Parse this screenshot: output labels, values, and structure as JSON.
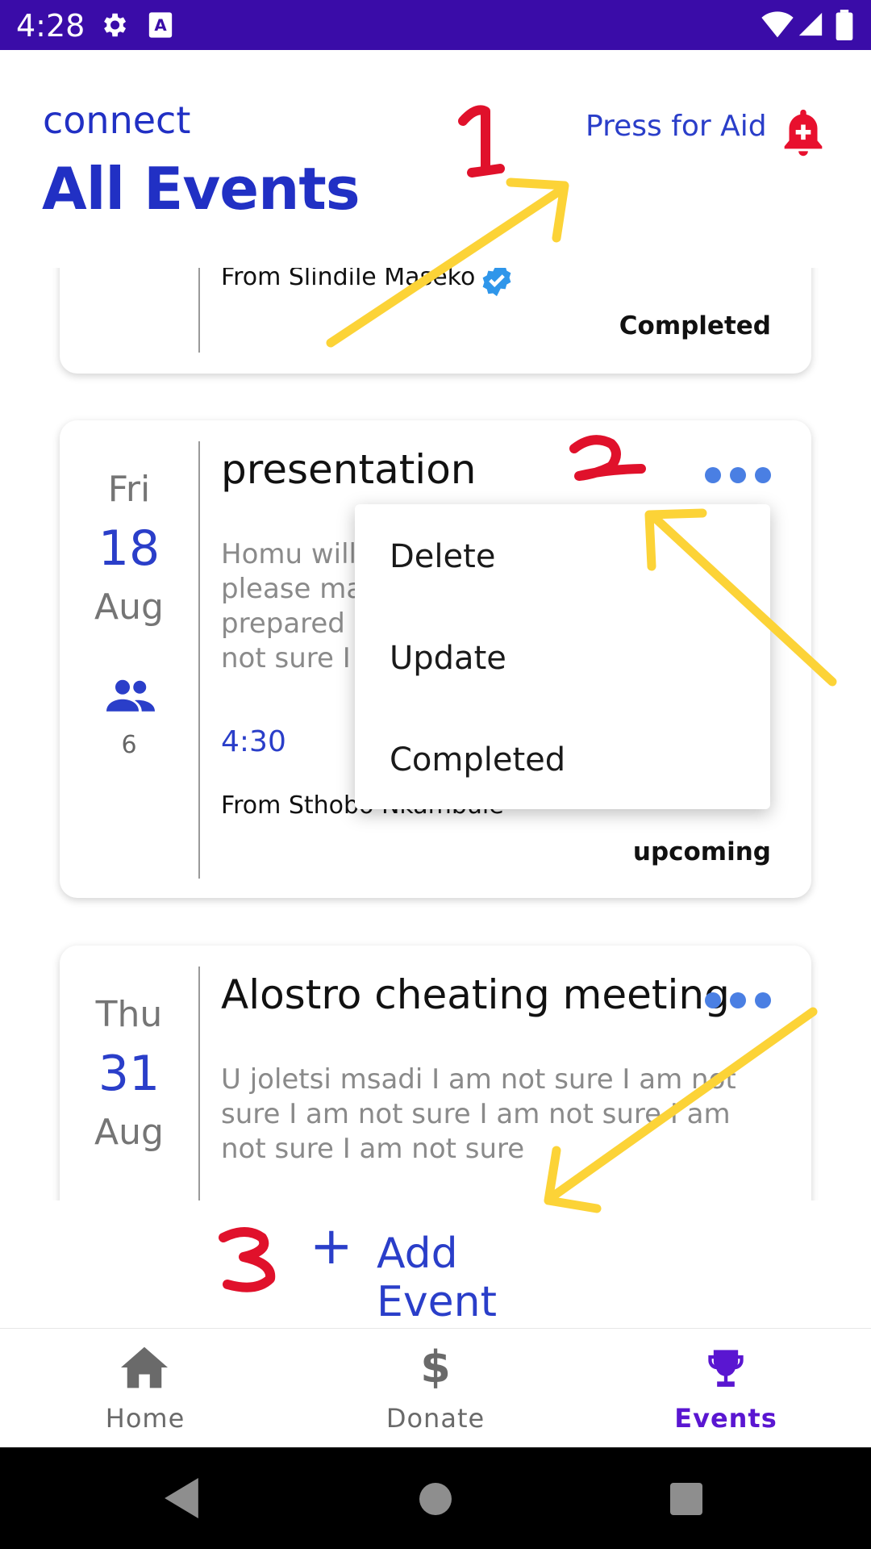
{
  "status_bar": {
    "time": "4:28"
  },
  "header": {
    "app_name": "connect",
    "title": "All Events",
    "aid_label": "Press for Aid"
  },
  "events": [
    {
      "from": "From Slindile Maseko",
      "status": "Completed"
    },
    {
      "day": "Fri",
      "date": "18",
      "month": "Aug",
      "title": "presentation",
      "description_lines": [
        "Homu will",
        "please ma",
        "prepared w",
        "not sure I a"
      ],
      "attendees": "6",
      "time": "4:30",
      "from": "From Sthobo Nkambule",
      "status": "upcoming"
    },
    {
      "day": "Thu",
      "date": "31",
      "month": "Aug",
      "title": "Alostro cheating meeting",
      "description": "U joletsi msadi I am not sure I am not sure I am not sure I am not sure I am not sure I am not sure"
    }
  ],
  "menu": {
    "items": [
      "Delete",
      "Update",
      "Completed"
    ]
  },
  "add_event": {
    "label": "Add Event"
  },
  "bottom_nav": {
    "items": [
      "Home",
      "Donate",
      "Events"
    ],
    "active": "Events"
  },
  "annotations": {
    "labels": [
      "1",
      "2",
      "3"
    ]
  },
  "colors": {
    "status_bar": "#3a0ca8",
    "primary": "#2a3ec9",
    "active_tab": "#5a16d1",
    "alert": "#e8102e",
    "arrow": "#fcd337",
    "annotation": "#e0112b"
  }
}
